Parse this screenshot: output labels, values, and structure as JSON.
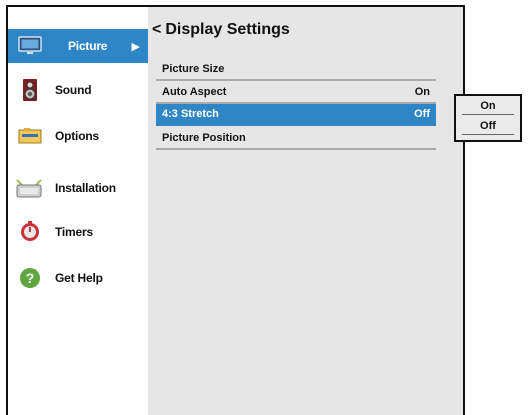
{
  "sidebar": {
    "items": [
      {
        "label": "Picture",
        "icon": "monitor-icon",
        "selected": true,
        "arrow": "▶"
      },
      {
        "label": "Sound",
        "icon": "speaker-icon"
      },
      {
        "label": "Options",
        "icon": "options-icon"
      },
      {
        "label": "Installation",
        "icon": "installation-icon"
      },
      {
        "label": "Timers",
        "icon": "timer-icon"
      },
      {
        "label": "Get Help",
        "icon": "help-icon"
      }
    ]
  },
  "header": {
    "back": "<",
    "title": "Display Settings"
  },
  "menu": {
    "rows": [
      {
        "label": "Picture Size",
        "value": ""
      },
      {
        "label": "Auto Aspect",
        "value": "On"
      },
      {
        "label": "4:3 Stretch",
        "value": "Off",
        "selected": true
      },
      {
        "label": "Picture Position",
        "value": ""
      }
    ]
  },
  "popup": {
    "options": [
      "On",
      "Off"
    ]
  },
  "colors": {
    "accent": "#2f86c6",
    "panel": "#e6e6e6"
  }
}
